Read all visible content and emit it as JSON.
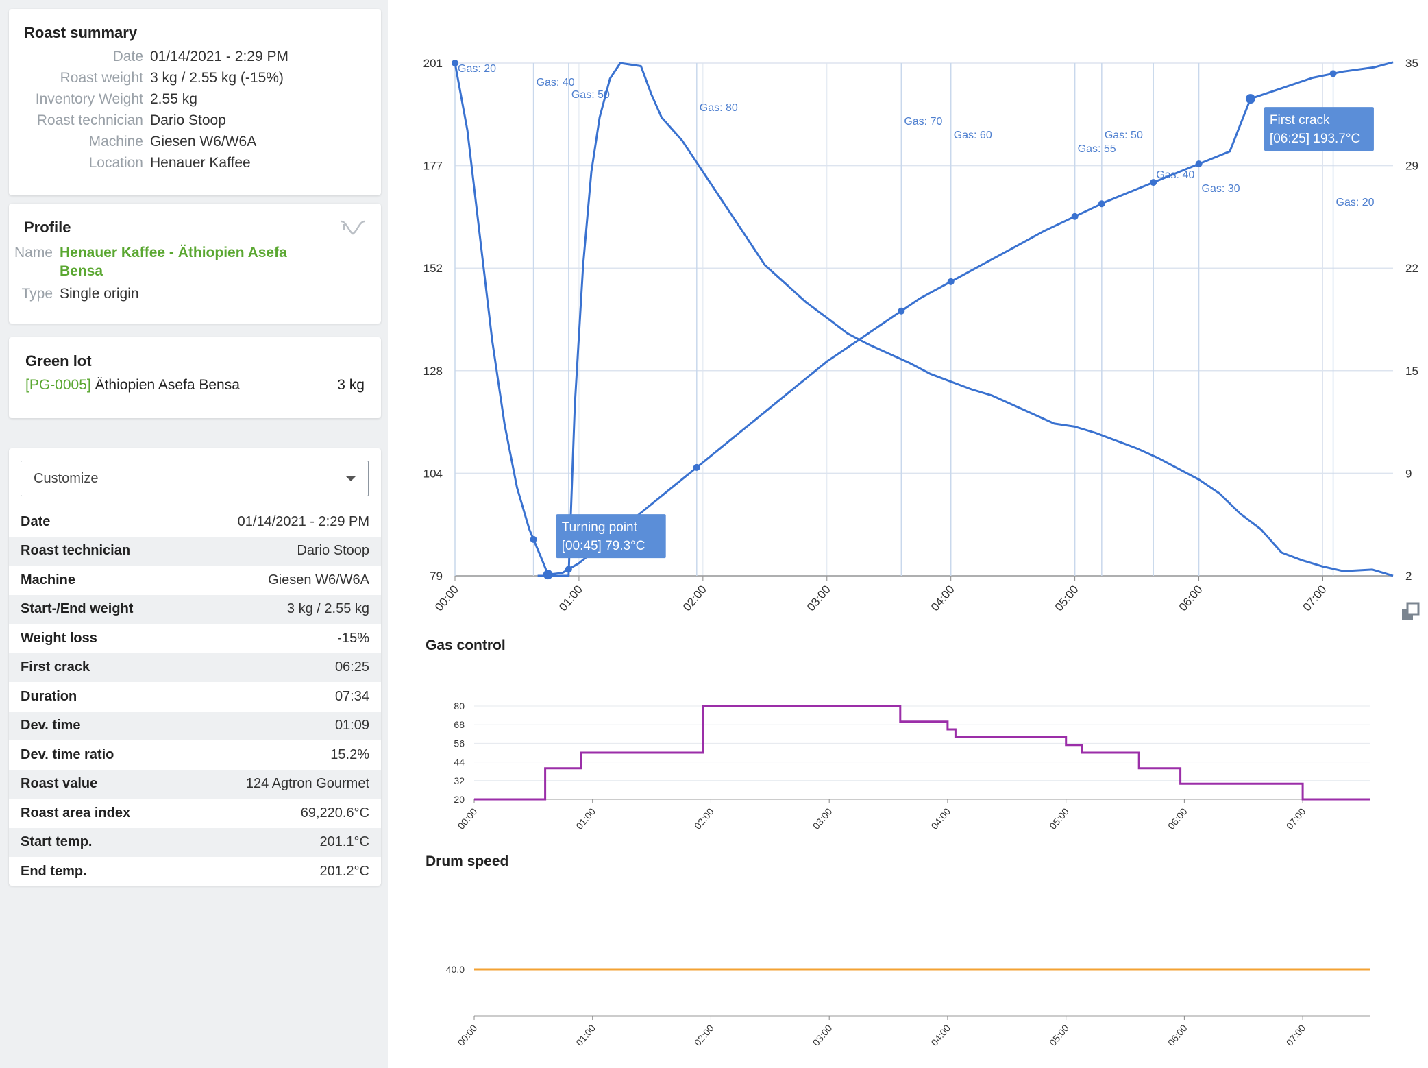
{
  "roast_summary": {
    "title": "Roast summary",
    "rows": [
      {
        "label": "Date",
        "value": "01/14/2021 - 2:29 PM"
      },
      {
        "label": "Roast weight",
        "value": "3 kg / 2.55 kg (-15%)"
      },
      {
        "label": "Inventory Weight",
        "value": "2.55 kg"
      },
      {
        "label": "Roast technician",
        "value": "Dario Stoop"
      },
      {
        "label": "Machine",
        "value": "Giesen W6/W6A"
      },
      {
        "label": "Location",
        "value": "Henauer Kaffee"
      }
    ]
  },
  "profile": {
    "title": "Profile",
    "name_label": "Name",
    "name_value": "Henauer Kaffee - Äthiopien Asefa Bensa",
    "type_label": "Type",
    "type_value": "Single origin",
    "icon": "unlink-curves-icon"
  },
  "green_lot": {
    "title": "Green lot",
    "code": "[PG-0005]",
    "name": "Äthiopien Asefa Bensa",
    "qty": "3 kg"
  },
  "customize": {
    "select_value": "Customize",
    "rows": [
      {
        "label": "Date",
        "value": "01/14/2021 - 2:29 PM"
      },
      {
        "label": "Roast technician",
        "value": "Dario Stoop"
      },
      {
        "label": "Machine",
        "value": "Giesen W6/W6A"
      },
      {
        "label": "Start-/End weight",
        "value": "3 kg / 2.55 kg"
      },
      {
        "label": "Weight loss",
        "value": "-15%"
      },
      {
        "label": "First crack",
        "value": "06:25"
      },
      {
        "label": "Duration",
        "value": "07:34"
      },
      {
        "label": "Dev. time",
        "value": "01:09"
      },
      {
        "label": "Dev. time ratio",
        "value": "15.2%"
      },
      {
        "label": "Roast value",
        "value": "124 Agtron Gourmet"
      },
      {
        "label": "Roast area index",
        "value": "69,220.6°C"
      },
      {
        "label": "Start temp.",
        "value": "201.1°C"
      },
      {
        "label": "End temp.",
        "value": "201.2°C"
      }
    ]
  },
  "colors": {
    "temp": "#3a72d0",
    "gas": "#9b2ea8",
    "drum": "#f3a233",
    "green": "#5aa731",
    "grid": "#dde4ef",
    "event_line": "#c9d8ec",
    "tooltip_bg": "#5b8ed8"
  },
  "chart_data": [
    {
      "type": "line",
      "x_unit": "mm:ss",
      "xlim": [
        0,
        454
      ],
      "x_ticks": [
        "00:00",
        "01:00",
        "02:00",
        "03:00",
        "04:00",
        "05:00",
        "06:00",
        "07:00"
      ],
      "y_left_ticks": [
        "79",
        "104",
        "128",
        "152",
        "177",
        "201"
      ],
      "ylim_left": [
        79,
        201
      ],
      "y_right_ticks": [
        "2",
        "9",
        "15",
        "22",
        "29",
        "35"
      ],
      "ylim_right": [
        2,
        35
      ],
      "grid": true,
      "series": [
        {
          "color": "#3a72d0",
          "axis": "left",
          "values": [
            [
              0,
              201
            ],
            [
              6,
              185
            ],
            [
              12,
              160
            ],
            [
              18,
              135
            ],
            [
              24,
              115
            ],
            [
              30,
              100
            ],
            [
              36,
              90
            ],
            [
              42,
              83
            ],
            [
              45,
              79.3
            ],
            [
              52,
              79.7
            ],
            [
              60,
              82
            ],
            [
              75,
              88
            ],
            [
              90,
              94
            ],
            [
              105,
              100
            ],
            [
              120,
              106
            ],
            [
              135,
              112
            ],
            [
              150,
              118
            ],
            [
              165,
              124
            ],
            [
              180,
              130
            ],
            [
              195,
              135
            ],
            [
              210,
              140
            ],
            [
              225,
              145
            ],
            [
              240,
              149
            ],
            [
              255,
              153
            ],
            [
              270,
              157
            ],
            [
              285,
              161
            ],
            [
              300,
              164.5
            ],
            [
              315,
              168
            ],
            [
              330,
              171
            ],
            [
              345,
              174
            ],
            [
              360,
              177
            ],
            [
              375,
              180
            ],
            [
              385,
              192.5
            ],
            [
              400,
              195
            ],
            [
              415,
              197.5
            ],
            [
              430,
              199
            ],
            [
              445,
              200
            ],
            [
              454,
              201.2
            ]
          ]
        },
        {
          "color": "#3a72d0",
          "axis": "right",
          "values": [
            [
              40,
              2
            ],
            [
              55,
              2
            ],
            [
              58,
              13
            ],
            [
              62,
              22
            ],
            [
              66,
              28
            ],
            [
              70,
              31.5
            ],
            [
              75,
              34
            ],
            [
              80,
              35
            ],
            [
              90,
              34.8
            ],
            [
              95,
              33
            ],
            [
              100,
              31.5
            ],
            [
              110,
              30
            ],
            [
              120,
              28
            ],
            [
              130,
              26
            ],
            [
              140,
              24
            ],
            [
              150,
              22
            ],
            [
              160,
              20.8
            ],
            [
              170,
              19.6
            ],
            [
              180,
              18.6
            ],
            [
              190,
              17.6
            ],
            [
              200,
              16.9
            ],
            [
              210,
              16.3
            ],
            [
              220,
              15.7
            ],
            [
              230,
              15
            ],
            [
              240,
              14.5
            ],
            [
              250,
              14
            ],
            [
              260,
              13.6
            ],
            [
              270,
              13
            ],
            [
              280,
              12.4
            ],
            [
              290,
              11.8
            ],
            [
              300,
              11.6
            ],
            [
              310,
              11.2
            ],
            [
              320,
              10.7
            ],
            [
              330,
              10.2
            ],
            [
              340,
              9.6
            ],
            [
              350,
              8.9
            ],
            [
              360,
              8.2
            ],
            [
              370,
              7.3
            ],
            [
              380,
              6
            ],
            [
              390,
              5
            ],
            [
              400,
              3.5
            ],
            [
              410,
              3
            ],
            [
              420,
              2.6
            ],
            [
              430,
              2.3
            ],
            [
              444,
              2.4
            ],
            [
              454,
              2
            ]
          ]
        }
      ],
      "event_markers": [
        {
          "t": 0,
          "label": "Gas: 20"
        },
        {
          "t": 38,
          "label": "Gas: 40"
        },
        {
          "t": 55,
          "label": "Gas: 50"
        },
        {
          "t": 117,
          "label": "Gas: 80"
        },
        {
          "t": 216,
          "label": "Gas: 70"
        },
        {
          "t": 240,
          "label": "Gas: 60"
        },
        {
          "t": 300,
          "label": "Gas: 55"
        },
        {
          "t": 313,
          "label": "Gas: 50"
        },
        {
          "t": 338,
          "label": "Gas: 40"
        },
        {
          "t": 360,
          "label": "Gas: 30"
        },
        {
          "t": 425,
          "label": "Gas: 20"
        }
      ],
      "annotations": [
        {
          "t": 45,
          "line1": "Turning point",
          "line2": "[00:45] 79.3°C"
        },
        {
          "t": 385,
          "line1": "First crack",
          "line2": "[06:25] 193.7°C"
        }
      ]
    },
    {
      "type": "line",
      "title": "Gas control",
      "x_ticks": [
        "00:00",
        "01:00",
        "02:00",
        "03:00",
        "04:00",
        "05:00",
        "06:00",
        "07:00"
      ],
      "y_ticks": [
        "20",
        "32",
        "44",
        "56",
        "68",
        "80"
      ],
      "ylim": [
        20,
        80
      ],
      "xlim": [
        0,
        454
      ],
      "color": "#9b2ea8",
      "values": [
        [
          0,
          20
        ],
        [
          36,
          20
        ],
        [
          36,
          40
        ],
        [
          54,
          40
        ],
        [
          54,
          50
        ],
        [
          116,
          50
        ],
        [
          116,
          80
        ],
        [
          216,
          80
        ],
        [
          216,
          70
        ],
        [
          240,
          70
        ],
        [
          240,
          65
        ],
        [
          244,
          65
        ],
        [
          244,
          60
        ],
        [
          300,
          60
        ],
        [
          300,
          55
        ],
        [
          308,
          55
        ],
        [
          308,
          50
        ],
        [
          337,
          50
        ],
        [
          337,
          40
        ],
        [
          358,
          40
        ],
        [
          358,
          30
        ],
        [
          420,
          30
        ],
        [
          420,
          20
        ],
        [
          454,
          20
        ]
      ]
    },
    {
      "type": "line",
      "title": "Drum speed",
      "x_ticks": [
        "00:00",
        "01:00",
        "02:00",
        "03:00",
        "04:00",
        "05:00",
        "06:00",
        "07:00"
      ],
      "y_ticks": [
        "40.0"
      ],
      "xlim": [
        0,
        454
      ],
      "color": "#f3a233",
      "values": [
        [
          0,
          40
        ],
        [
          454,
          40
        ]
      ]
    }
  ]
}
